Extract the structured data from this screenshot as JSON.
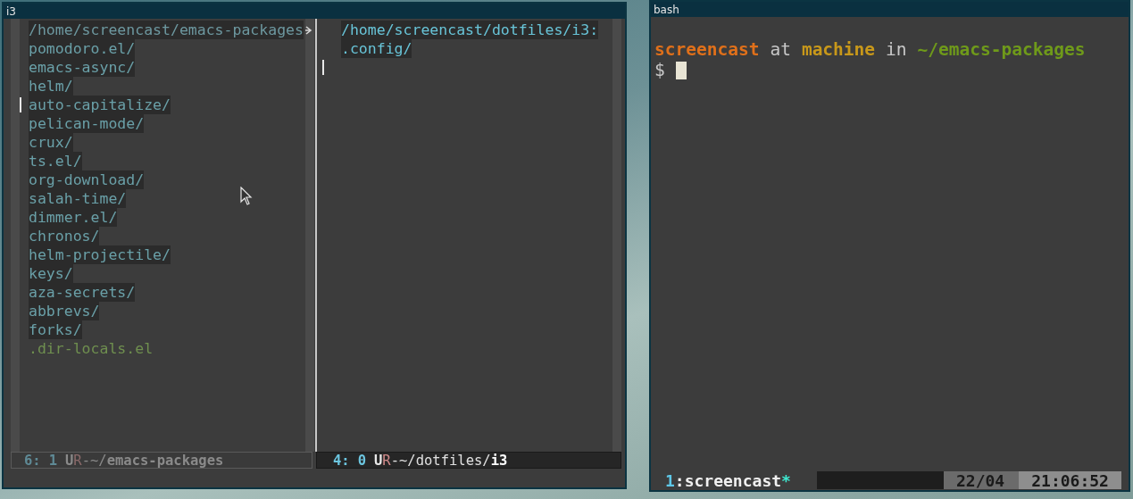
{
  "windows": [
    {
      "kind": "emacs",
      "title": "i3",
      "panes": [
        {
          "active": false,
          "header": "/home/screencast/emacs-packages",
          "header_truncated": true,
          "cursor_on_blank_line": false,
          "entries": [
            {
              "name": "pomodoro.el/",
              "kind": "dir",
              "current": false
            },
            {
              "name": "emacs-async/",
              "kind": "dir",
              "current": false
            },
            {
              "name": "helm/",
              "kind": "dir",
              "current": false
            },
            {
              "name": "auto-capitalize/",
              "kind": "dir",
              "current": true
            },
            {
              "name": "pelican-mode/",
              "kind": "dir",
              "current": false
            },
            {
              "name": "crux/",
              "kind": "dir",
              "current": false
            },
            {
              "name": "ts.el/",
              "kind": "dir",
              "current": false
            },
            {
              "name": "org-download/",
              "kind": "dir",
              "current": false
            },
            {
              "name": "salah-time/",
              "kind": "dir",
              "current": false
            },
            {
              "name": "dimmer.el/",
              "kind": "dir",
              "current": false
            },
            {
              "name": "chronos/",
              "kind": "dir",
              "current": false
            },
            {
              "name": "helm-projectile/",
              "kind": "dir",
              "current": false
            },
            {
              "name": "keys/",
              "kind": "dir",
              "current": false
            },
            {
              "name": "aza-secrets/",
              "kind": "dir",
              "current": false
            },
            {
              "name": "abbrevs/",
              "kind": "dir",
              "current": false
            },
            {
              "name": "forks/",
              "kind": "dir",
              "current": false
            },
            {
              "name": ".dir-locals.el",
              "kind": "file",
              "current": false
            }
          ],
          "mode_line": [
            {
              "text": "6:",
              "color": "#5f8a96",
              "bold": true
            },
            {
              "text": "1",
              "color": "#5f8a96",
              "bold": true
            },
            {
              "text": "U",
              "color": "#8a8a8a",
              "bold": true
            },
            {
              "text": "R",
              "color": "#8a6a6a",
              "bold": false
            },
            {
              "text": "-~/",
              "color": "#8a8a8a",
              "bold": false
            },
            {
              "text": "emacs-packages",
              "color": "#8a8a8a",
              "bold": true
            }
          ]
        },
        {
          "active": true,
          "header": "/home/screencast/dotfiles/i3:",
          "header_truncated": false,
          "cursor_on_blank_line": true,
          "entries": [
            {
              "name": ".config/",
              "kind": "dir",
              "current": false
            }
          ],
          "mode_line": [
            {
              "text": "4:",
              "color": "#6cc6e0",
              "bold": true
            },
            {
              "text": "0",
              "color": "#6cc6e0",
              "bold": true
            },
            {
              "text": "U",
              "color": "#e8e8e8",
              "bold": true
            },
            {
              "text": "R",
              "color": "#d08a8a",
              "bold": false
            },
            {
              "text": "-~/dotfiles/",
              "color": "#e0e0e0",
              "bold": false
            },
            {
              "text": "i3",
              "color": "#ffffff",
              "bold": true
            }
          ]
        }
      ]
    },
    {
      "kind": "terminal",
      "title": "bash",
      "prompt": [
        {
          "text": "screencast",
          "color": "#e0701a"
        },
        {
          "text": "at",
          "color": "#c8c8c8"
        },
        {
          "text": "machine",
          "color": "#c8981a"
        },
        {
          "text": "in",
          "color": "#c8c8c8"
        },
        {
          "text": "~/emacs-packages",
          "color": "#6f9a1a"
        }
      ],
      "input_prompt": "$",
      "status_bar": {
        "session": [
          {
            "text": "1",
            "color": "#5ec8e8"
          },
          {
            "text": ":screencast",
            "color": "#f0f0f0"
          },
          {
            "text": "*",
            "color": "#3ee8d0"
          }
        ],
        "date": "22/04",
        "time": "21:06:52"
      }
    }
  ]
}
